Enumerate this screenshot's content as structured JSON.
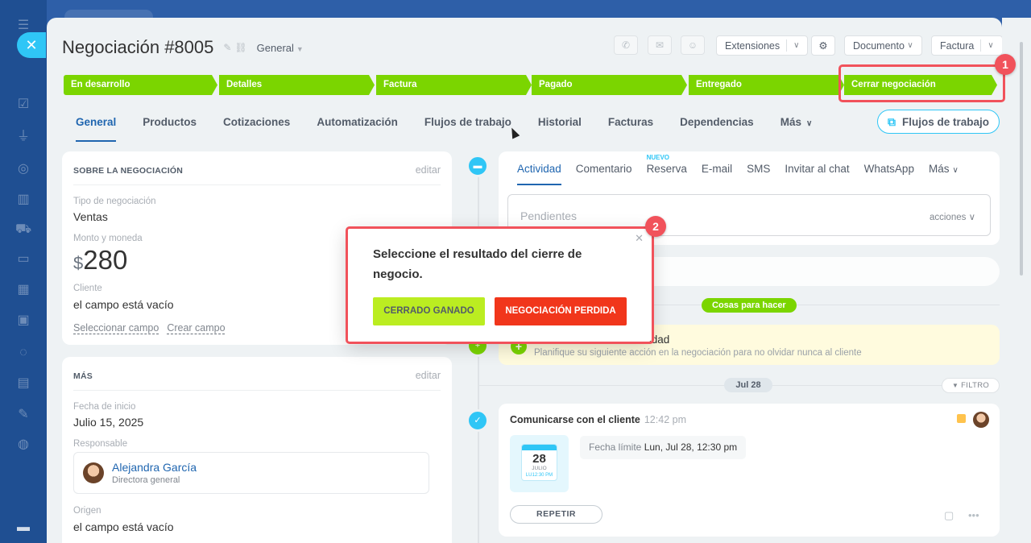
{
  "deal": {
    "title": "Negociación #8005",
    "category": "General"
  },
  "header": {
    "extensions": "Extensiones",
    "document": "Documento",
    "invoice": "Factura"
  },
  "stages": [
    {
      "label": "En desarrollo"
    },
    {
      "label": "Detalles"
    },
    {
      "label": "Factura"
    },
    {
      "label": "Pagado"
    },
    {
      "label": "Entregado"
    },
    {
      "label": "Cerrar negociación"
    }
  ],
  "callouts": {
    "stage": "1",
    "popup": "2"
  },
  "tabs": [
    {
      "label": "General"
    },
    {
      "label": "Productos"
    },
    {
      "label": "Cotizaciones"
    },
    {
      "label": "Automatización"
    },
    {
      "label": "Flujos de trabajo"
    },
    {
      "label": "Historial"
    },
    {
      "label": "Facturas"
    },
    {
      "label": "Dependencias"
    },
    {
      "label": "Más"
    }
  ],
  "flows_button": "Flujos de trabajo",
  "about": {
    "heading": "SOBRE LA NEGOCIACIÓN",
    "edit": "editar",
    "type_label": "Tipo de negociación",
    "type_value": "Ventas",
    "amount_label": "Monto y moneda",
    "currency": "$",
    "amount": "280",
    "client_label": "Cliente",
    "client_value": "el campo está vacío",
    "select_field": "Seleccionar campo",
    "create_field": "Crear campo"
  },
  "more": {
    "heading": "MÁS",
    "edit": "editar",
    "start_label": "Fecha de inicio",
    "start_value": "Julio 15, 2025",
    "resp_label": "Responsable",
    "resp_name": "Alejandra García",
    "resp_role": "Directora general",
    "origin_label": "Origen",
    "origin_value": "el campo está vacío"
  },
  "editor": {
    "tabs": [
      "Actividad",
      "Comentario",
      "Reserva",
      "E-mail",
      "SMS",
      "Invitar al chat",
      "WhatsApp",
      "Más"
    ],
    "new_badge": "NUEVO",
    "placeholder": "Pendientes",
    "actions": "acciones"
  },
  "timeline": {
    "todo_badge": "Cosas para hacer",
    "hint_title": "vidad",
    "hint_sub": "Planifique su siguiente acción en la negociación para no olvidar nunca al cliente",
    "date": "Jul 28",
    "filter": "FILTRO",
    "activity": {
      "title": "Comunicarse con el cliente",
      "time": "12:42 pm",
      "cal_day": "28",
      "cal_month": "JULIO",
      "cal_time": "LU12:30 PM",
      "deadline_label": "Fecha límite",
      "deadline_value": "Lun, Jul 28, 12:30 pm",
      "repeat": "REPETIR"
    }
  },
  "popup": {
    "question": "Seleccione el resultado del cierre de negocio.",
    "won": "CERRADO GANADO",
    "lost": "NEGOCIACIÓN PERDIDA"
  },
  "colors": {
    "stage": "#7bd500",
    "accent": "#2fc6f6",
    "highlight": "#f1525b",
    "won": "#bbed21",
    "lost": "#f1361b"
  }
}
